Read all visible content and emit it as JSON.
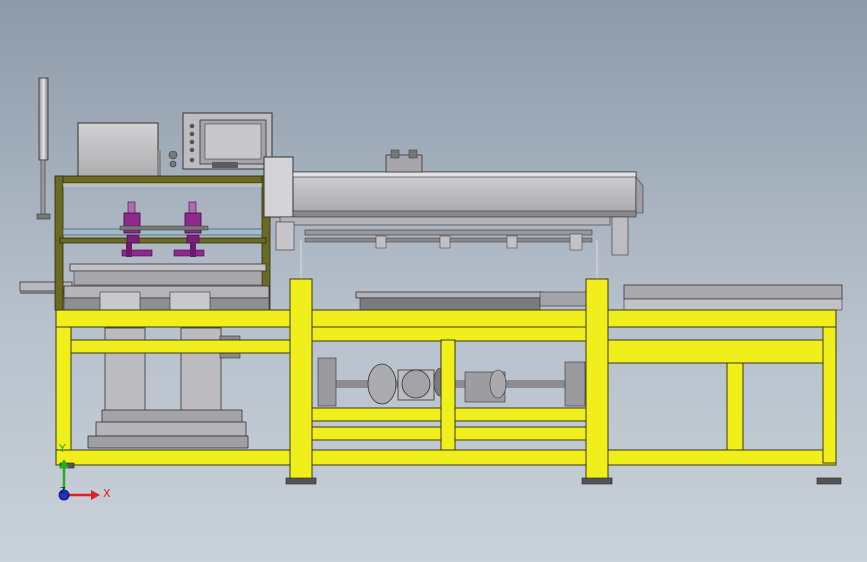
{
  "viewport": {
    "background_top": "#8d9aa9",
    "background_bottom": "#c9d1d9"
  },
  "colors": {
    "frame_yellow": "#f0ef1c",
    "frame_outline": "#3a3a10",
    "olive_frame": "#6b6a22",
    "machine_gray": "#c6c6c8",
    "dark_gray": "#5a5a5e",
    "purple_parts": "#8e2a8e",
    "axis_x": "#e02020",
    "axis_y": "#20b020",
    "axis_z": "#2030d0"
  },
  "triad": {
    "x_label": "X",
    "y_label": "Y",
    "z_label": "Z"
  }
}
